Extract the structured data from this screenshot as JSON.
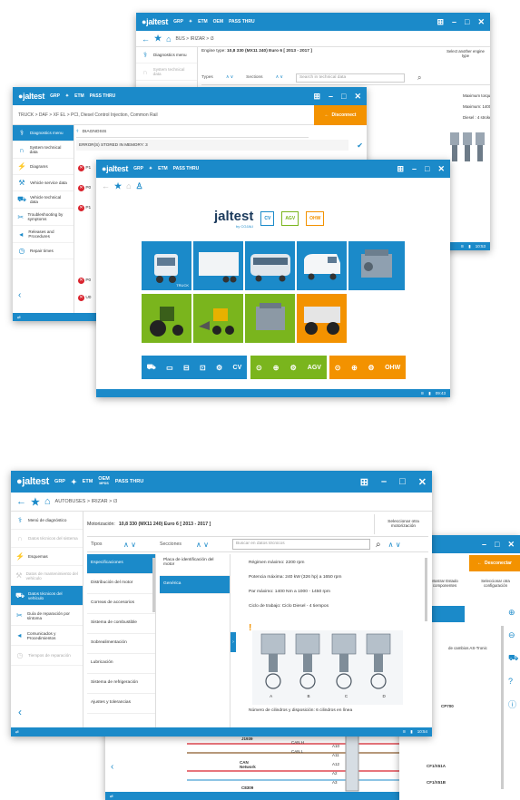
{
  "top_window": {
    "menu": [
      "GRP",
      "ETM",
      "OEM",
      "PASS THRU"
    ],
    "oem_sub": "MPDS",
    "pass_sub": "THRU",
    "breadcrumb": "BUS > IRIZAR > i3",
    "sidebar": [
      "Diagnostics menu",
      "System technical data"
    ],
    "engine_label": "Engine type:",
    "engine_value": "10,8 330 (MX11 240) Euro 6 [ 2013 - 2017 ]",
    "select_another": "Select another engine type",
    "types_label": "Types",
    "sections_label": "Sections",
    "search_placeholder": "Search in technical data",
    "spec_lines": [
      "Maximum torque: 240 kW (326 hp) a 1650 rpm",
      "Maximum: 1400 Nm a 1000 - 1450 rpm",
      "Diesel : 4 stroke"
    ],
    "status_time": "10:53"
  },
  "middle_window": {
    "menu": [
      "GRP",
      "ETM",
      "PASS THRU"
    ],
    "breadcrumb": "TRUCK > DAF > XF EL > PCI, Diesel Control Injection, Common Rail",
    "disconnect": "Disconnect",
    "sidebar": [
      "Diagnostics menu",
      "System technical data",
      "Diagrams",
      "Vehicle service data",
      "Vehicle technical data",
      "Troubleshooting by symptoms",
      "Releases and Procedures",
      "Repair times"
    ],
    "diagnosis_label": "DIAGNOSIS",
    "errors_label": "ERROR(S) STORED IN MEMORY: 3",
    "error_prefix": [
      "P1",
      "P0",
      "P1"
    ],
    "footer_items": [
      "P0",
      "U0"
    ]
  },
  "front_window": {
    "menu": [
      "GRP",
      "ETM",
      "PASS THRU"
    ],
    "brand": "jaltest",
    "brand_sub": "by COJALI",
    "badges": [
      "CV",
      "AGV",
      "OHW"
    ],
    "tile_label_truck": "TRUCK",
    "status_time": "09:43",
    "colors": {
      "cv": "#1b8ac9",
      "agv": "#7ab51d",
      "ohw": "#f39200"
    }
  },
  "bottom_window": {
    "menu": [
      "GRP",
      "ETM",
      "OEM",
      "PASS THRU"
    ],
    "oem_sub": "MPDS",
    "pass_sub": "THRU",
    "breadcrumb": "AUTOBUSES > IRIZAR > i3",
    "sidebar": [
      "Menú de diagnóstico",
      "Datos técnicos del sistema",
      "Esquemas",
      "Datos de mantenimiento del vehículo",
      "Datos técnicos del vehículo",
      "Guía de reparación por síntoma",
      "Comunicados y Procedimientos",
      "Tiempos de reparación"
    ],
    "engine_label": "Motorización:",
    "engine_value": "10,8 330 (MX11 240) Euro 6 [ 2013 - 2017 ]",
    "select_another": "Seleccionar otra motorización",
    "types_label": "Tipos",
    "sections_label": "Secciones",
    "search_placeholder": "Buscar en datos técnicos",
    "types": [
      "Especificaciones",
      "Distribución del motor",
      "Correas de accesorios",
      "Sistema de combustible",
      "Sobrealimentación",
      "Lubricación",
      "Sistema de refrigeración",
      "Ajustes y tolerancias"
    ],
    "sections": [
      "Placa de identificación del motor",
      "Genérica"
    ],
    "spec_lines": [
      "Régimen máximo: 2200 rpm",
      "Potencia máxima: 240 kW (326 hp) a 1650 rpm",
      "Par máximo: 1400 Nm a 1000 - 1450 rpm",
      "Ciclo de trabajo: Ciclo Diesel - 4 tiempos"
    ],
    "cylinder_labels": [
      "A",
      "B",
      "C",
      "D"
    ],
    "cylinder_caption": "Número de cilindros y disposición: 6 cilindros en línea",
    "status_time": "10:54"
  },
  "right_window": {
    "desconectar": "Desconectar",
    "mostrar": "Mostrar Estado componentes",
    "seleccionar": "Seleccionar otra configuración",
    "cambio": "de cambios AS-Tronic",
    "labels": [
      "CP700",
      "CF1/X51A",
      "CF1/X51B"
    ]
  },
  "diagram_window": {
    "labels": [
      "J1939",
      "CAN H",
      "CAN L",
      "CAN Network",
      "A10",
      "A11",
      "A12",
      "A2",
      "A3",
      "C8309"
    ]
  }
}
